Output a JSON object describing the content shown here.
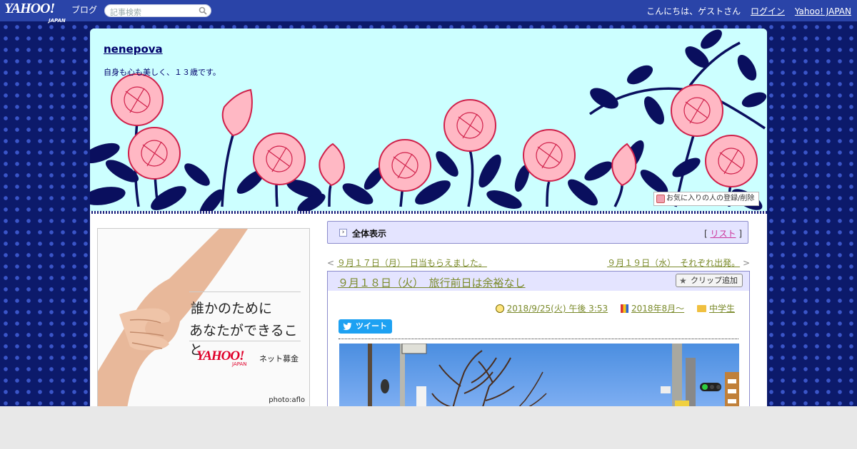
{
  "topbar": {
    "logo": "YAHOO!",
    "logo_sub": "JAPAN",
    "service": "ブログ",
    "search_placeholder": "記事検索",
    "greeting": "こんにちは、ゲストさん",
    "login": "ログイン",
    "yahoo_japan": "Yahoo! JAPAN"
  },
  "blog": {
    "title": "nenepova",
    "description": "自身も心も美しく、１３歳です。",
    "fav_button": "お気に入りの人の登録/削除"
  },
  "ad": {
    "line1": "誰かのために",
    "line2": "あなたができること",
    "logo": "YAHOO!",
    "logo_sub": "JAPAN",
    "label": "ネット募金",
    "credit": "photo:aflo"
  },
  "list_bar": {
    "title": "全体表示",
    "list_open": "[",
    "list_link": "リスト",
    "list_close": "]"
  },
  "nav": {
    "prev_arrow": "<",
    "prev": "９月１７日（月）　日当もらえました。",
    "next": "９月１９日（水）　それぞれ出発。",
    "next_arrow": ">"
  },
  "article": {
    "title": "９月１８日（火）　旅行前日は余裕なし",
    "clip": "クリップ追加",
    "date": "2018/9/25(火) 午後 3:53",
    "book": "2018年8月～",
    "category": "中学生",
    "tweet": "ツイート"
  },
  "colors": {
    "topbar": "#2a44a8",
    "header_bg": "#ccffff",
    "rose_fill": "#ffb8c4",
    "rose_stroke": "#d0204a",
    "leaf": "#0a0f5e",
    "link_olive": "#7a8a2a",
    "link_pink": "#cc3399"
  }
}
